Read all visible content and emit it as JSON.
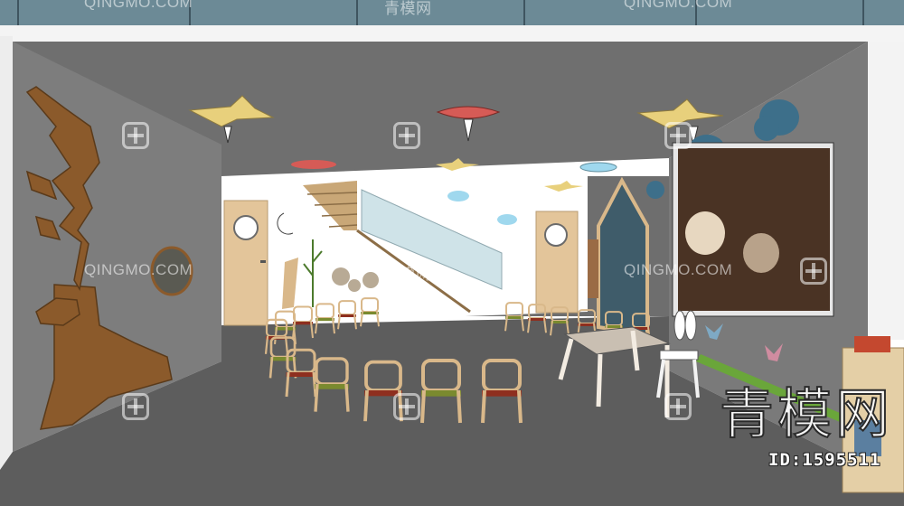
{
  "watermarks": {
    "logo_text": "QINGMO.COM",
    "brand_cn": "青模网",
    "brand_top": "青模网"
  },
  "id_label": "ID:1595511",
  "colors": {
    "wall": "#7b7b7b",
    "wall_dark": "#6b6b6b",
    "floor": "#5e5e5e",
    "ceiling": "#6f6f6f",
    "wood": "#d9b88a",
    "deer": "#8b5a2b",
    "door": "#e6c9a0",
    "chair_seat_green": "#7a8a2f",
    "chair_seat_red": "#8e2f1f",
    "screen": "#3f2a1e",
    "sky_cloud": "#3d6f8a"
  }
}
